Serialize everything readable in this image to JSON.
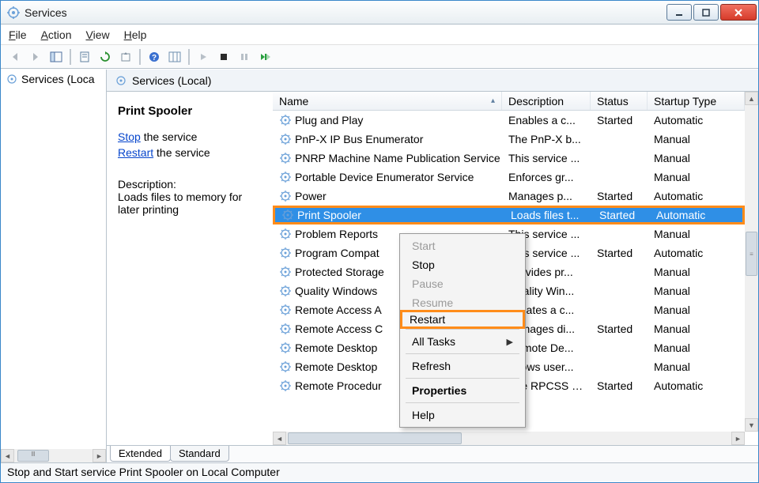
{
  "window": {
    "title": "Services"
  },
  "menu": {
    "file": "File",
    "action": "Action",
    "view": "View",
    "help": "Help"
  },
  "tree": {
    "root": "Services (Loca"
  },
  "panel_header": "Services (Local)",
  "detail": {
    "name": "Print Spooler",
    "stop_link": "Stop",
    "stop_suffix": " the service",
    "restart_link": "Restart",
    "restart_suffix": " the service",
    "desc_label": "Description:",
    "desc_text": "Loads files to memory for later printing"
  },
  "columns": {
    "name": "Name",
    "desc": "Description",
    "status": "Status",
    "startup": "Startup Type"
  },
  "rows": [
    {
      "name": "Plug and Play",
      "desc": "Enables a c...",
      "status": "Started",
      "startup": "Automatic"
    },
    {
      "name": "PnP-X IP Bus Enumerator",
      "desc": "The PnP-X b...",
      "status": "",
      "startup": "Manual"
    },
    {
      "name": "PNRP Machine Name Publication Service",
      "desc": "This service ...",
      "status": "",
      "startup": "Manual"
    },
    {
      "name": "Portable Device Enumerator Service",
      "desc": "Enforces gr...",
      "status": "",
      "startup": "Manual"
    },
    {
      "name": "Power",
      "desc": "Manages p...",
      "status": "Started",
      "startup": "Automatic"
    },
    {
      "name": "Print Spooler",
      "desc": "Loads files t...",
      "status": "Started",
      "startup": "Automatic",
      "selected": true
    },
    {
      "name": "Problem Reports",
      "desc": "This service ...",
      "status": "",
      "startup": "Manual"
    },
    {
      "name": "Program Compat",
      "desc": "This service ...",
      "status": "Started",
      "startup": "Automatic"
    },
    {
      "name": "Protected Storage",
      "desc": "Provides pr...",
      "status": "",
      "startup": "Manual"
    },
    {
      "name": "Quality Windows",
      "desc": "Quality Win...",
      "status": "",
      "startup": "Manual"
    },
    {
      "name": "Remote Access A",
      "desc": "Creates a c...",
      "status": "",
      "startup": "Manual"
    },
    {
      "name": "Remote Access C",
      "desc": "Manages di...",
      "status": "Started",
      "startup": "Manual"
    },
    {
      "name": "Remote Desktop",
      "desc": "Remote De...",
      "status": "",
      "startup": "Manual"
    },
    {
      "name": "Remote Desktop",
      "desc": "Allows user...",
      "status": "",
      "startup": "Manual"
    },
    {
      "name": "Remote Procedur",
      "desc": "The RPCSS s...",
      "status": "Started",
      "startup": "Automatic"
    }
  ],
  "context_menu": {
    "start": "Start",
    "stop": "Stop",
    "pause": "Pause",
    "resume": "Resume",
    "restart": "Restart",
    "all_tasks": "All Tasks",
    "refresh": "Refresh",
    "properties": "Properties",
    "help": "Help"
  },
  "tabs": {
    "extended": "Extended",
    "standard": "Standard"
  },
  "statusbar": "Stop and Start service Print Spooler on Local Computer"
}
